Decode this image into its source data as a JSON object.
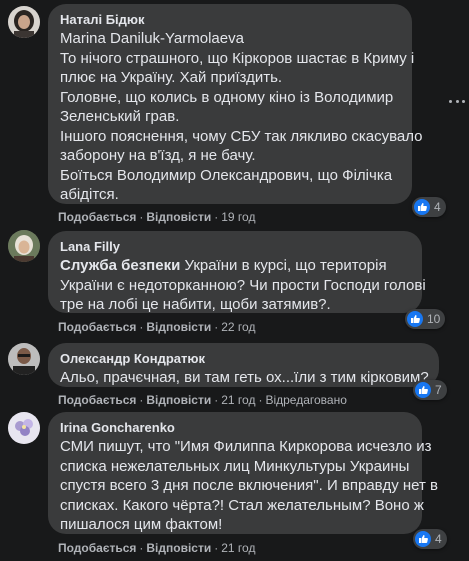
{
  "comments": [
    {
      "author": "Наталі Бідюк",
      "lines": [
        "Marina Daniluk-Yarmolaeva",
        "То нічого страшного, що Кіркоров шастає в Криму і",
        "плює на Україну. Хай приїздить.",
        "Головне, що колись в одному кіно із Володимир",
        "Зеленський грав.",
        "Іншого пояснення, чому СБУ так лякливо скасувало",
        "заборону на в'їзд, я не бачу.",
        "Боїться Володимир Олександрович, що Філічка",
        "абідітся."
      ],
      "like": "Подобається",
      "reply": "Відповісти",
      "time": "19 год",
      "reactions": "4"
    },
    {
      "author": "Lana Filly",
      "mention": "Служба безпеки",
      "lines": [
        " України в курсі, що територія",
        "України є недоторканною? Чи прости Господи голові",
        "тре на лобі це набити, щоби затямив?."
      ],
      "like": "Подобається",
      "reply": "Відповісти",
      "time": "22 год",
      "reactions": "10"
    },
    {
      "author": "Олександр Кондратюк",
      "lines": [
        "Альо, прачєчная, ви там геть ох...їли з тим кірковим?"
      ],
      "like": "Подобається",
      "reply": "Відповісти",
      "time": "21 год",
      "edited": "Відредаговано",
      "reactions": "7"
    },
    {
      "author": "Irina Goncharenko",
      "lines": [
        "СМИ пишут, что \"Имя Филиппа Киркорова исчезло из",
        "списка нежелательных лиц Минкультуры Украины",
        "спустя всего 3 дня после включения\". И вправду нет в",
        "списках. Какого чёрта?! Стал желательным? Воно ж",
        "пишалося цим фактом!"
      ],
      "like": "Подобається",
      "reply": "Відповісти",
      "time": "21 год",
      "reactions": "4"
    }
  ],
  "colors": {
    "background": "#18191a",
    "bubble": "#3a3b3c",
    "like_blue": "#1877f2",
    "secondary_text": "#b0b3b8"
  },
  "icons": [
    "avatar",
    "thumbs-up-icon",
    "more-options-icon"
  ]
}
